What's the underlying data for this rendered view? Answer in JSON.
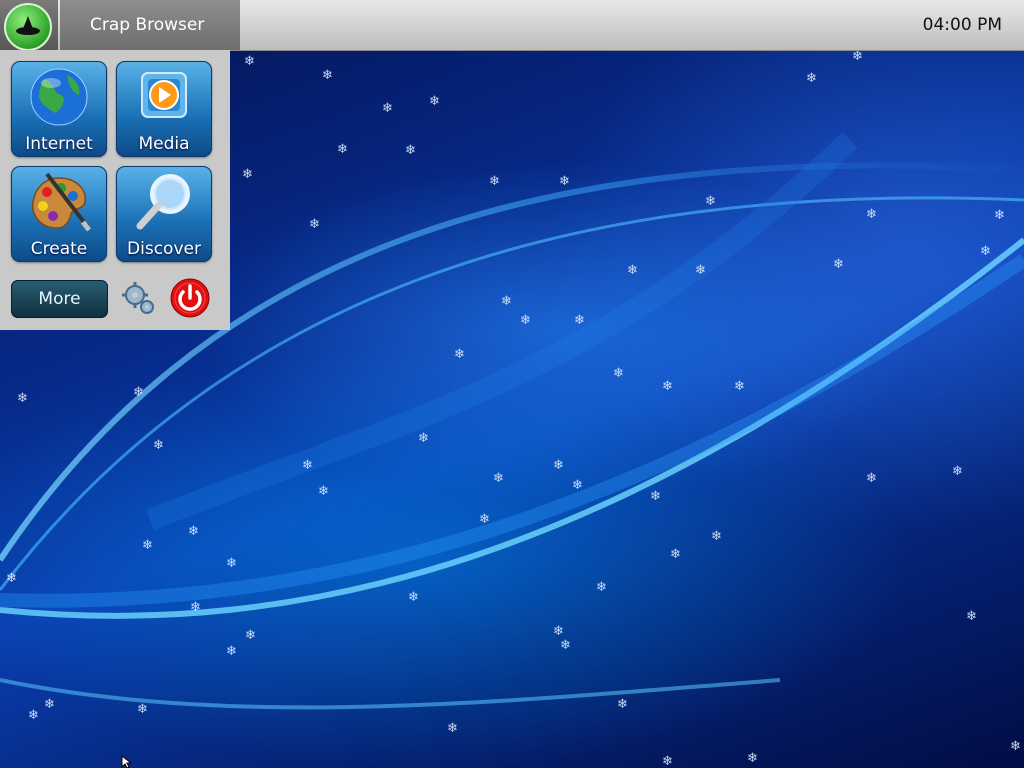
{
  "taskbar": {
    "start_icon": "hat-icon",
    "open_window_title": "Crap Browser",
    "clock": "04:00 PM"
  },
  "launcher": {
    "tiles": [
      {
        "label": "Internet",
        "icon": "globe-icon"
      },
      {
        "label": "Media",
        "icon": "media-play-icon"
      },
      {
        "label": "Create",
        "icon": "paint-palette-icon"
      },
      {
        "label": "Discover",
        "icon": "magnifier-icon"
      }
    ],
    "more_label": "More",
    "settings_icon": "gears-icon",
    "power_icon": "power-icon"
  },
  "colors": {
    "tile_blue": "#1a6fb4",
    "power_red": "#e01010",
    "start_green": "#2ea02a"
  }
}
